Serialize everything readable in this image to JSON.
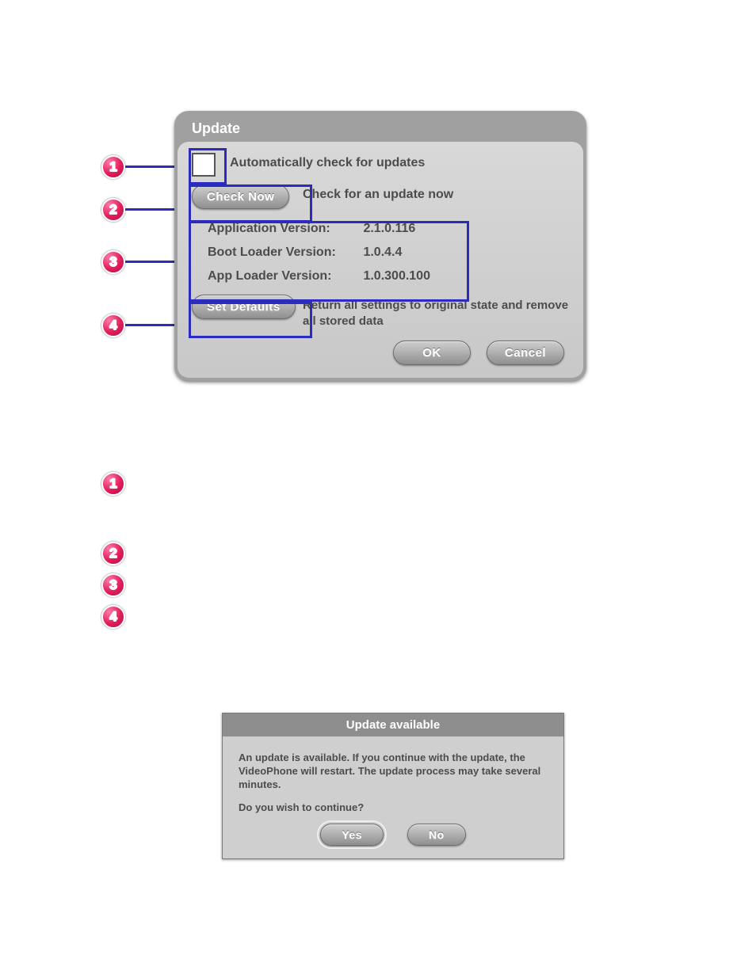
{
  "badges": {
    "n1": "1",
    "n2": "2",
    "n3": "3",
    "n4": "4"
  },
  "update_dialog": {
    "title": "Update",
    "auto_check_label": "Automatically check for updates",
    "check_now_button": "Check Now",
    "check_now_label": "Check for an update now",
    "versions": {
      "app_label": "Application Version:",
      "app_value": "2.1.0.116",
      "boot_label": "Boot Loader Version:",
      "boot_value": "1.0.4.4",
      "apploader_label": "App Loader Version:",
      "apploader_value": "1.0.300.100"
    },
    "set_defaults_button": "Set Defaults",
    "set_defaults_label": "Return all settings to original state and remove all stored data",
    "ok_button": "OK",
    "cancel_button": "Cancel"
  },
  "available_dialog": {
    "title": "Update available",
    "body": "An update is available.  If you continue with the update, the VideoPhone will restart.  The update process may take several minutes.",
    "question": "Do you wish to continue?",
    "yes_button": "Yes",
    "no_button": "No"
  }
}
